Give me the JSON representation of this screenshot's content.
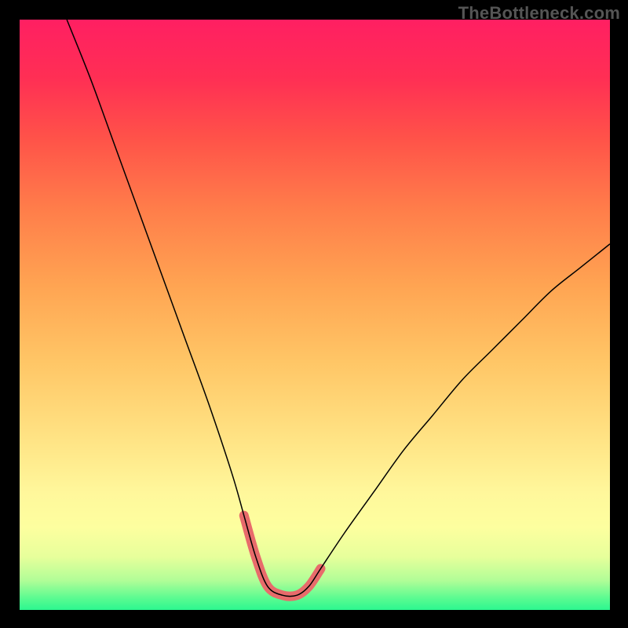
{
  "watermark": "TheBottleneck.com",
  "chart_data": {
    "type": "line",
    "title": "",
    "xlabel": "",
    "ylabel": "",
    "xlim": [
      0,
      100
    ],
    "ylim": [
      0,
      100
    ],
    "grid": false,
    "series": [
      {
        "name": "bottleneck-curve",
        "x": [
          8,
          12,
          16,
          20,
          24,
          28,
          32,
          36,
          38,
          40,
          42,
          44.5,
          47,
          49,
          51,
          55,
          60,
          65,
          70,
          75,
          80,
          85,
          90,
          95,
          100
        ],
        "y": [
          100,
          90,
          79,
          68,
          57,
          46,
          35,
          23,
          16,
          9,
          4,
          2.5,
          2.5,
          4,
          7,
          13,
          20,
          27,
          33,
          39,
          44,
          49,
          54,
          58,
          62
        ]
      }
    ],
    "highlight": {
      "name": "optimal-range",
      "x": [
        38.0,
        40.0,
        42.0,
        44.5,
        47.0,
        49.0,
        51.0
      ],
      "y": [
        16,
        9,
        4,
        2.5,
        2.5,
        4,
        7
      ]
    }
  }
}
